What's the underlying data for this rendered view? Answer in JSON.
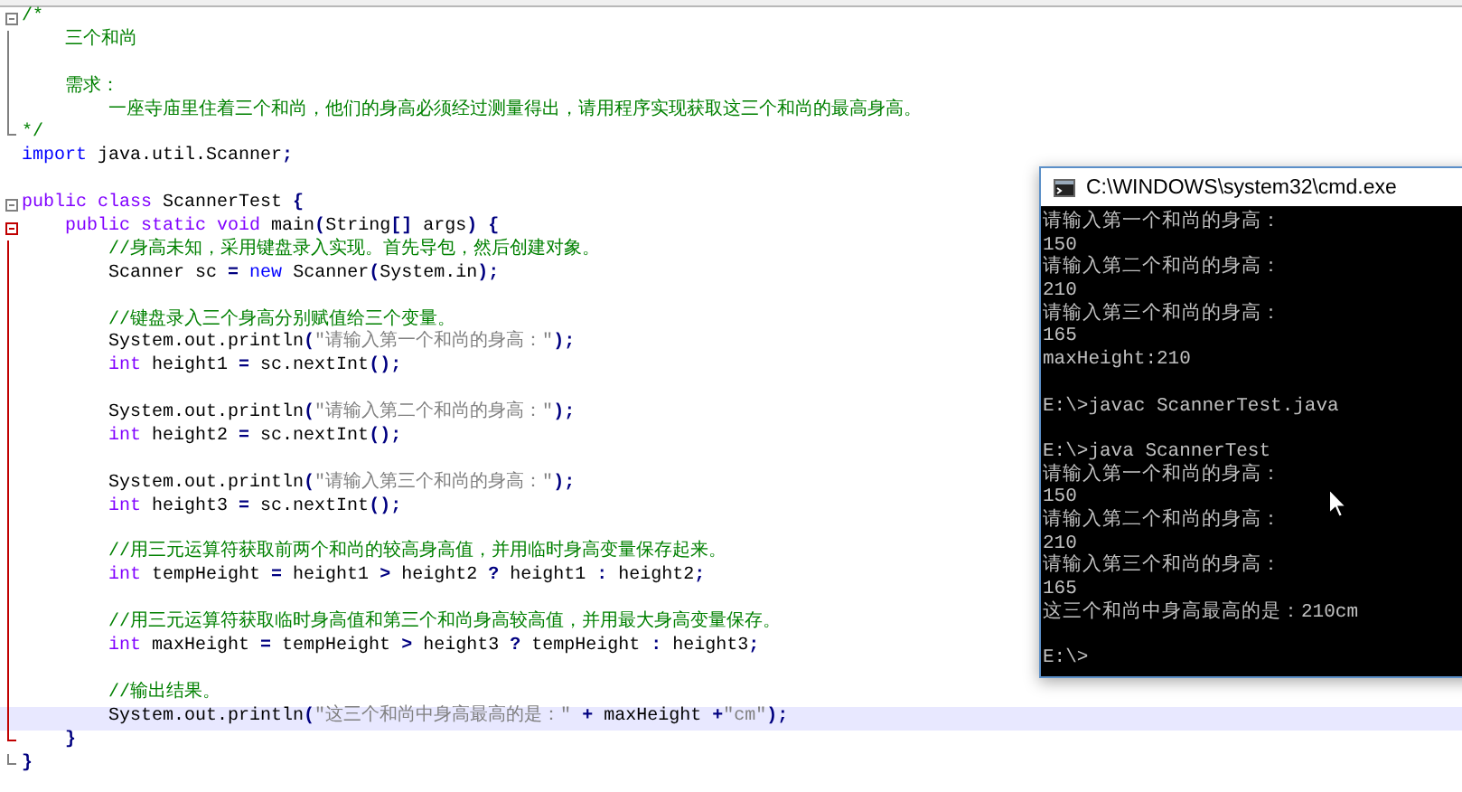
{
  "editor": {
    "lines": [
      {
        "current": false,
        "fold": {
          "kind": "start",
          "color": "#808080"
        },
        "tokens": [
          {
            "kind": "comment",
            "text": "/*"
          }
        ]
      },
      {
        "current": false,
        "fold": {
          "kind": "mid",
          "color": "#808080"
        },
        "tokens": [
          {
            "kind": "comment",
            "text": "    三个和尚"
          }
        ]
      },
      {
        "current": false,
        "fold": {
          "kind": "mid",
          "color": "#808080"
        }
      },
      {
        "current": false,
        "fold": {
          "kind": "mid",
          "color": "#808080"
        },
        "tokens": [
          {
            "kind": "comment",
            "text": "    需求："
          }
        ]
      },
      {
        "current": false,
        "fold": {
          "kind": "mid",
          "color": "#808080"
        },
        "tokens": [
          {
            "kind": "comment",
            "text": "        一座寺庙里住着三个和尚，他们的身高必须经过测量得出，请用程序实现获取这三个和尚的最高身高。"
          }
        ]
      },
      {
        "current": false,
        "fold": {
          "kind": "end",
          "color": "#808080"
        },
        "tokens": [
          {
            "kind": "comment",
            "text": "*/"
          }
        ]
      },
      {
        "current": false,
        "tokens": [
          {
            "kind": "directive",
            "text": "import"
          },
          {
            "kind": "plain",
            "text": " java.util.Scanner"
          },
          {
            "kind": "operator",
            "text": ";"
          }
        ]
      },
      {
        "current": false
      },
      {
        "current": false,
        "fold": {
          "kind": "start",
          "color": "#808080"
        },
        "tokens": [
          {
            "kind": "keyword",
            "text": "public class"
          },
          {
            "kind": "plain",
            "text": " ScannerTest "
          },
          {
            "kind": "operator",
            "text": "{"
          }
        ]
      },
      {
        "current": false,
        "fold": {
          "kind": "start",
          "color": "#c00000"
        },
        "tokens": [
          {
            "kind": "keyword",
            "text": "    public static void"
          },
          {
            "kind": "plain",
            "text": " main"
          },
          {
            "kind": "operator",
            "text": "("
          },
          {
            "kind": "plain",
            "text": "String"
          },
          {
            "kind": "operator",
            "text": "[]"
          },
          {
            "kind": "plain",
            "text": " args"
          },
          {
            "kind": "operator",
            "text": ") {"
          }
        ]
      },
      {
        "current": false,
        "fold": {
          "kind": "mid",
          "color": "#c00000"
        },
        "tokens": [
          {
            "kind": "comment",
            "text": "        //身高未知，采用键盘录入实现。首先导包，然后创建对象。"
          }
        ]
      },
      {
        "current": false,
        "fold": {
          "kind": "mid",
          "color": "#c00000"
        },
        "tokens": [
          {
            "kind": "plain",
            "text": "        Scanner sc "
          },
          {
            "kind": "operator",
            "text": "="
          },
          {
            "kind": "directive",
            "text": " new"
          },
          {
            "kind": "plain",
            "text": " Scanner"
          },
          {
            "kind": "operator",
            "text": "("
          },
          {
            "kind": "plain",
            "text": "System.in"
          },
          {
            "kind": "operator",
            "text": ");"
          }
        ]
      },
      {
        "current": false,
        "fold": {
          "kind": "mid",
          "color": "#c00000"
        }
      },
      {
        "current": false,
        "fold": {
          "kind": "mid",
          "color": "#c00000"
        },
        "tokens": [
          {
            "kind": "comment",
            "text": "        //键盘录入三个身高分别赋值给三个变量。"
          }
        ]
      },
      {
        "current": false,
        "fold": {
          "kind": "mid",
          "color": "#c00000"
        },
        "tokens": [
          {
            "kind": "plain",
            "text": "        System.out.println"
          },
          {
            "kind": "operator",
            "text": "("
          },
          {
            "kind": "string",
            "text": "\"请输入第一个和尚的身高：\""
          },
          {
            "kind": "operator",
            "text": ");"
          }
        ]
      },
      {
        "current": false,
        "fold": {
          "kind": "mid",
          "color": "#c00000"
        },
        "tokens": [
          {
            "kind": "keyword",
            "text": "        int"
          },
          {
            "kind": "plain",
            "text": " height1 "
          },
          {
            "kind": "operator",
            "text": "="
          },
          {
            "kind": "plain",
            "text": " sc.nextInt"
          },
          {
            "kind": "operator",
            "text": "();"
          }
        ]
      },
      {
        "current": false,
        "fold": {
          "kind": "mid",
          "color": "#c00000"
        }
      },
      {
        "current": false,
        "fold": {
          "kind": "mid",
          "color": "#c00000"
        },
        "tokens": [
          {
            "kind": "plain",
            "text": "        System.out.println"
          },
          {
            "kind": "operator",
            "text": "("
          },
          {
            "kind": "string",
            "text": "\"请输入第二个和尚的身高：\""
          },
          {
            "kind": "operator",
            "text": ");"
          }
        ]
      },
      {
        "current": false,
        "fold": {
          "kind": "mid",
          "color": "#c00000"
        },
        "tokens": [
          {
            "kind": "keyword",
            "text": "        int"
          },
          {
            "kind": "plain",
            "text": " height2 "
          },
          {
            "kind": "operator",
            "text": "="
          },
          {
            "kind": "plain",
            "text": " sc.nextInt"
          },
          {
            "kind": "operator",
            "text": "();"
          }
        ]
      },
      {
        "current": false,
        "fold": {
          "kind": "mid",
          "color": "#c00000"
        }
      },
      {
        "current": false,
        "fold": {
          "kind": "mid",
          "color": "#c00000"
        },
        "tokens": [
          {
            "kind": "plain",
            "text": "        System.out.println"
          },
          {
            "kind": "operator",
            "text": "("
          },
          {
            "kind": "string",
            "text": "\"请输入第三个和尚的身高：\""
          },
          {
            "kind": "operator",
            "text": ");"
          }
        ]
      },
      {
        "current": false,
        "fold": {
          "kind": "mid",
          "color": "#c00000"
        },
        "tokens": [
          {
            "kind": "keyword",
            "text": "        int"
          },
          {
            "kind": "plain",
            "text": " height3 "
          },
          {
            "kind": "operator",
            "text": "="
          },
          {
            "kind": "plain",
            "text": " sc.nextInt"
          },
          {
            "kind": "operator",
            "text": "();"
          }
        ]
      },
      {
        "current": false,
        "fold": {
          "kind": "mid",
          "color": "#c00000"
        }
      },
      {
        "current": false,
        "fold": {
          "kind": "mid",
          "color": "#c00000"
        },
        "tokens": [
          {
            "kind": "comment",
            "text": "        //用三元运算符获取前两个和尚的较高身高值，并用临时身高变量保存起来。"
          }
        ]
      },
      {
        "current": false,
        "fold": {
          "kind": "mid",
          "color": "#c00000"
        },
        "tokens": [
          {
            "kind": "keyword",
            "text": "        int"
          },
          {
            "kind": "plain",
            "text": " tempHeight "
          },
          {
            "kind": "operator",
            "text": "="
          },
          {
            "kind": "plain",
            "text": " height1 "
          },
          {
            "kind": "operator",
            "text": ">"
          },
          {
            "kind": "plain",
            "text": " height2 "
          },
          {
            "kind": "operator",
            "text": "?"
          },
          {
            "kind": "plain",
            "text": " height1 "
          },
          {
            "kind": "operator",
            "text": ":"
          },
          {
            "kind": "plain",
            "text": " height2"
          },
          {
            "kind": "operator",
            "text": ";"
          }
        ]
      },
      {
        "current": false,
        "fold": {
          "kind": "mid",
          "color": "#c00000"
        }
      },
      {
        "current": false,
        "fold": {
          "kind": "mid",
          "color": "#c00000"
        },
        "tokens": [
          {
            "kind": "comment",
            "text": "        //用三元运算符获取临时身高值和第三个和尚身高较高值，并用最大身高变量保存。"
          }
        ]
      },
      {
        "current": false,
        "fold": {
          "kind": "mid",
          "color": "#c00000"
        },
        "tokens": [
          {
            "kind": "keyword",
            "text": "        int"
          },
          {
            "kind": "plain",
            "text": " maxHeight "
          },
          {
            "kind": "operator",
            "text": "="
          },
          {
            "kind": "plain",
            "text": " tempHeight "
          },
          {
            "kind": "operator",
            "text": ">"
          },
          {
            "kind": "plain",
            "text": " height3 "
          },
          {
            "kind": "operator",
            "text": "?"
          },
          {
            "kind": "plain",
            "text": " tempHeight "
          },
          {
            "kind": "operator",
            "text": ":"
          },
          {
            "kind": "plain",
            "text": " height3"
          },
          {
            "kind": "operator",
            "text": ";"
          }
        ]
      },
      {
        "current": false,
        "fold": {
          "kind": "mid",
          "color": "#c00000"
        }
      },
      {
        "current": false,
        "fold": {
          "kind": "mid",
          "color": "#c00000"
        },
        "tokens": [
          {
            "kind": "comment",
            "text": "        //输出结果。"
          }
        ]
      },
      {
        "current": true,
        "fold": {
          "kind": "mid",
          "color": "#c00000"
        },
        "tokens": [
          {
            "kind": "plain",
            "text": "        System.out.println"
          },
          {
            "kind": "operator",
            "text": "("
          },
          {
            "kind": "string",
            "text": "\"这三个和尚中身高最高的是：\""
          },
          {
            "kind": "operator",
            "text": " +"
          },
          {
            "kind": "plain",
            "text": " maxHeight "
          },
          {
            "kind": "operator",
            "text": "+"
          },
          {
            "kind": "string",
            "text": "\"cm\""
          },
          {
            "kind": "operator",
            "text": ");"
          }
        ]
      },
      {
        "current": false,
        "fold": {
          "kind": "end",
          "color": "#c00000"
        },
        "tokens": [
          {
            "kind": "operator",
            "text": "    }"
          }
        ]
      },
      {
        "current": false,
        "fold": {
          "kind": "end",
          "color": "#808080"
        },
        "tokens": [
          {
            "kind": "operator",
            "text": "}"
          }
        ]
      }
    ]
  },
  "console": {
    "title": "C:\\WINDOWS\\system32\\cmd.exe",
    "blocks": [
      [
        "请输入第一个和尚的身高：",
        "150",
        "请输入第二个和尚的身高：",
        "210",
        "请输入第三个和尚的身高：",
        "165",
        "maxHeight:210"
      ],
      [
        "E:\\>javac ScannerTest.java"
      ],
      [
        "E:\\>java ScannerTest",
        "请输入第一个和尚的身高：",
        "150",
        "请输入第二个和尚的身高：",
        "210",
        "请输入第三个和尚的身高：",
        "165",
        "这三个和尚中身高最高的是：210cm"
      ],
      [
        "E:\\>"
      ]
    ]
  }
}
